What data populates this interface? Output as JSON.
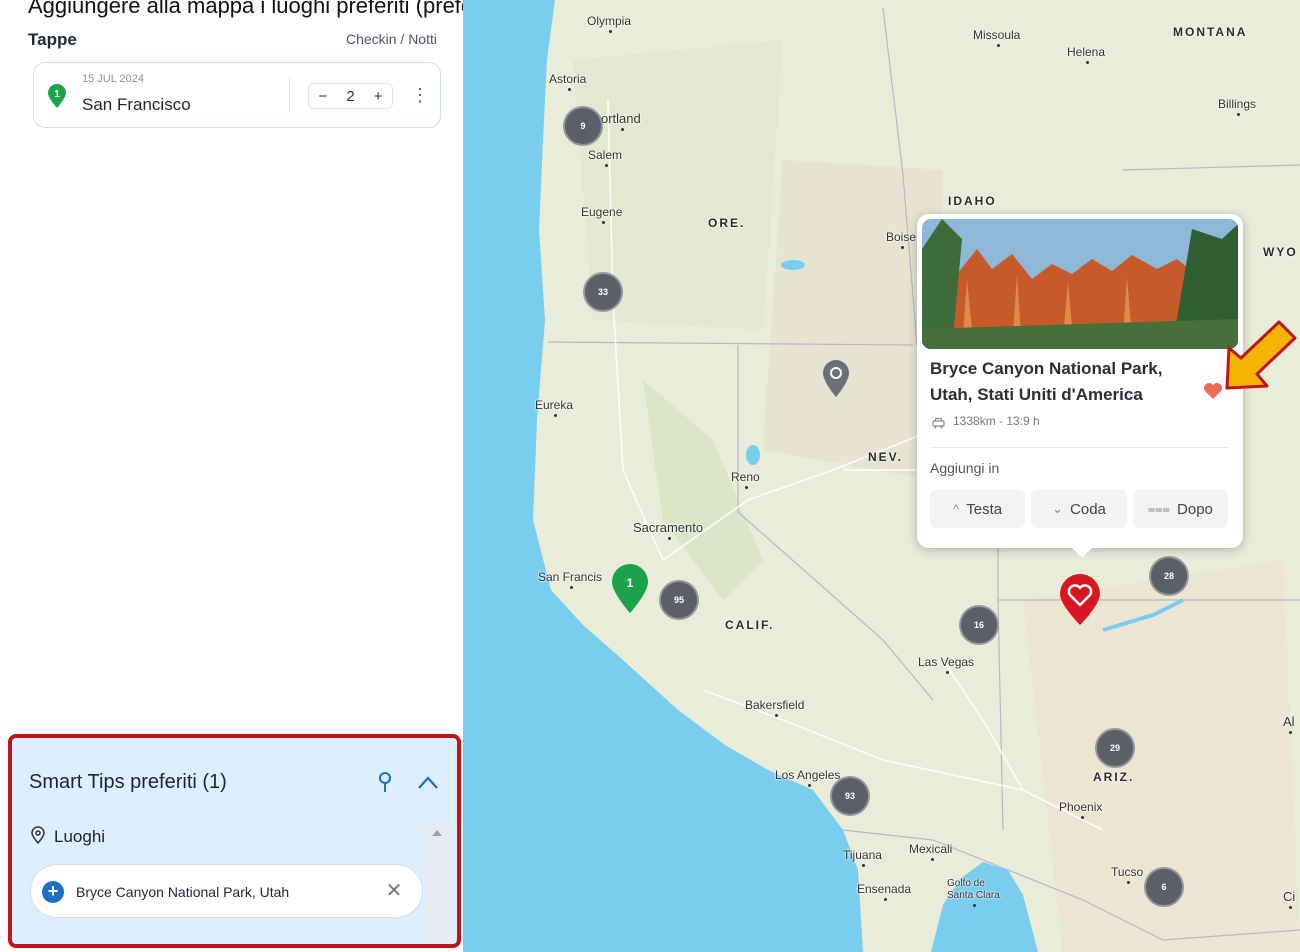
{
  "caption": "Aggiungere alla mappa i luoghi preferiti (preferiti)",
  "sidebar": {
    "tappe_title": "Tappe",
    "tappe_column_label": "Checkin / Notti",
    "stops": [
      {
        "index": "1",
        "date": "15 JUL 2024",
        "city": "San Francisco",
        "nights": "2",
        "minus": "−",
        "plus": "+",
        "menu": "⋮"
      }
    ],
    "favorites": {
      "title": "Smart Tips preferiti (1)",
      "section_label": "Luoghi",
      "items": [
        {
          "label": "Bryce Canyon National Park, Utah",
          "add": "+",
          "remove": "✕"
        }
      ]
    }
  },
  "map": {
    "places": {
      "olympia": "Olympia",
      "astoria": "Astoria",
      "portland": "ortland",
      "salem": "Salem",
      "eugene": "Eugene",
      "missoula": "Missoula",
      "helena": "Helena",
      "billings": "Billings",
      "boise": "Boise",
      "eureka": "Eureka",
      "reno": "Reno",
      "sacramento": "Sacramento",
      "san_francisco": "San Francis",
      "las_vegas": "Las Vegas",
      "bakersfield": "Bakersfield",
      "los_angeles": "Los Angeles",
      "phoenix": "Phoenix",
      "tijuana": "Tijuana",
      "mexicali": "Mexicali",
      "ensenada": "Ensenada",
      "golfo": "Golfo de\nSanta Clara",
      "tucson": "Tucso",
      "al": "Al",
      "ci": "Ci"
    },
    "states": {
      "montana": "MONTANA",
      "idaho": "IDAHO",
      "oregon": "ORE.",
      "wyoming": "WYO",
      "nevada": "NEV.",
      "california": "CALIF.",
      "arizona": "ARIZ."
    },
    "clusters": {
      "c9": "9",
      "c33": "33",
      "c95": "95",
      "c28": "28",
      "c16": "16",
      "c29": "29",
      "c93": "93",
      "c6": "6"
    },
    "start_pin_label": "1",
    "popup": {
      "title": "Bryce Canyon National Park, Utah, Stati Uniti d'America",
      "distance": "1338km - 13:9 h",
      "add_label": "Aggiungi in",
      "buttons": [
        {
          "icon": "^",
          "label": "Testa"
        },
        {
          "icon": "⌄",
          "label": "Coda"
        },
        {
          "icon": "⩶",
          "label": "Dopo"
        }
      ]
    },
    "colors": {
      "water": "#79cdee",
      "land": "#e9ecd9",
      "cluster": "#5a5f68",
      "start_pin": "#1aa34a",
      "favorite_marker": "#d8161f",
      "highlight_arrow": "#f5b400",
      "highlight_border": "#c0141c"
    }
  }
}
